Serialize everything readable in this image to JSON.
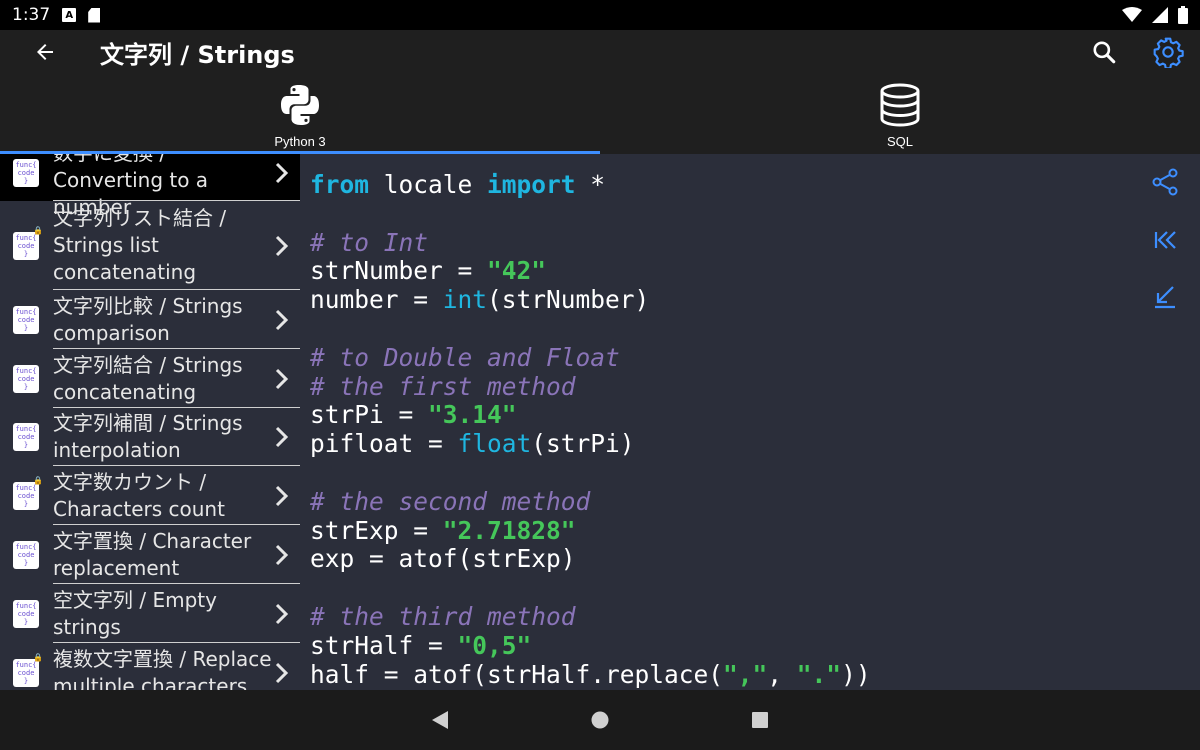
{
  "status": {
    "time": "1:37",
    "notif_letter": "A"
  },
  "appbar": {
    "title": "文字列 / Strings"
  },
  "tabs": [
    {
      "label": "Python 3",
      "icon": "python-icon",
      "active": true
    },
    {
      "label": "SQL",
      "icon": "database-icon",
      "active": false
    }
  ],
  "sidebar": {
    "items": [
      {
        "label": "数字に変換 / Converting to a number",
        "selected": true
      },
      {
        "label": "文字列リスト結合 / Strings list concatenating",
        "selected": false
      },
      {
        "label": "文字列比較 / Strings comparison",
        "selected": false
      },
      {
        "label": "文字列結合 / Strings concatenating",
        "selected": false
      },
      {
        "label": "文字列補間 / Strings interpolation",
        "selected": false
      },
      {
        "label": "文字数カウント / Characters count",
        "selected": false
      },
      {
        "label": "文字置換 / Character replacement",
        "selected": false
      },
      {
        "label": "空文字列 / Empty strings",
        "selected": false
      },
      {
        "label": "複数文字置換 / Replace multiple characters",
        "selected": false
      }
    ],
    "thumb_text": [
      "func{",
      "code",
      "}"
    ]
  },
  "code": {
    "lines": [
      [
        {
          "t": "from",
          "c": "kw"
        },
        {
          "t": " locale ",
          "c": ""
        },
        {
          "t": "import",
          "c": "kw"
        },
        {
          "t": " *",
          "c": ""
        }
      ],
      [],
      [
        {
          "t": "# to Int",
          "c": "cm"
        }
      ],
      [
        {
          "t": "strNumber = ",
          "c": ""
        },
        {
          "t": "\"42\"",
          "c": "str"
        }
      ],
      [
        {
          "t": "number = ",
          "c": ""
        },
        {
          "t": "int",
          "c": "fn"
        },
        {
          "t": "(strNumber)",
          "c": ""
        }
      ],
      [],
      [
        {
          "t": "# to Double and Float",
          "c": "cm"
        }
      ],
      [
        {
          "t": "# the first method",
          "c": "cm"
        }
      ],
      [
        {
          "t": "strPi = ",
          "c": ""
        },
        {
          "t": "\"3.14\"",
          "c": "str"
        }
      ],
      [
        {
          "t": "pifloat = ",
          "c": ""
        },
        {
          "t": "float",
          "c": "fn"
        },
        {
          "t": "(strPi)",
          "c": ""
        }
      ],
      [],
      [
        {
          "t": "# the second method",
          "c": "cm"
        }
      ],
      [
        {
          "t": "strExp = ",
          "c": ""
        },
        {
          "t": "\"2.71828\"",
          "c": "str"
        }
      ],
      [
        {
          "t": "exp = atof(strExp)",
          "c": ""
        }
      ],
      [],
      [
        {
          "t": "# the third method",
          "c": "cm"
        }
      ],
      [
        {
          "t": "strHalf = ",
          "c": ""
        },
        {
          "t": "\"0,5\"",
          "c": "str"
        }
      ],
      [
        {
          "t": "half = atof(strHalf.replace(",
          "c": ""
        },
        {
          "t": "\",\"",
          "c": "str"
        },
        {
          "t": ", ",
          "c": ""
        },
        {
          "t": "\".\"",
          "c": "str"
        },
        {
          "t": "))",
          "c": ""
        }
      ]
    ]
  },
  "tools": [
    "share-icon",
    "skip-to-start-icon",
    "scroll-to-end-icon"
  ],
  "colors": {
    "accent": "#3d8eff",
    "code_bg": "#2b2e3a",
    "keyword": "#1fb6e0",
    "string": "#45c75a",
    "comment": "#8a74b8"
  }
}
